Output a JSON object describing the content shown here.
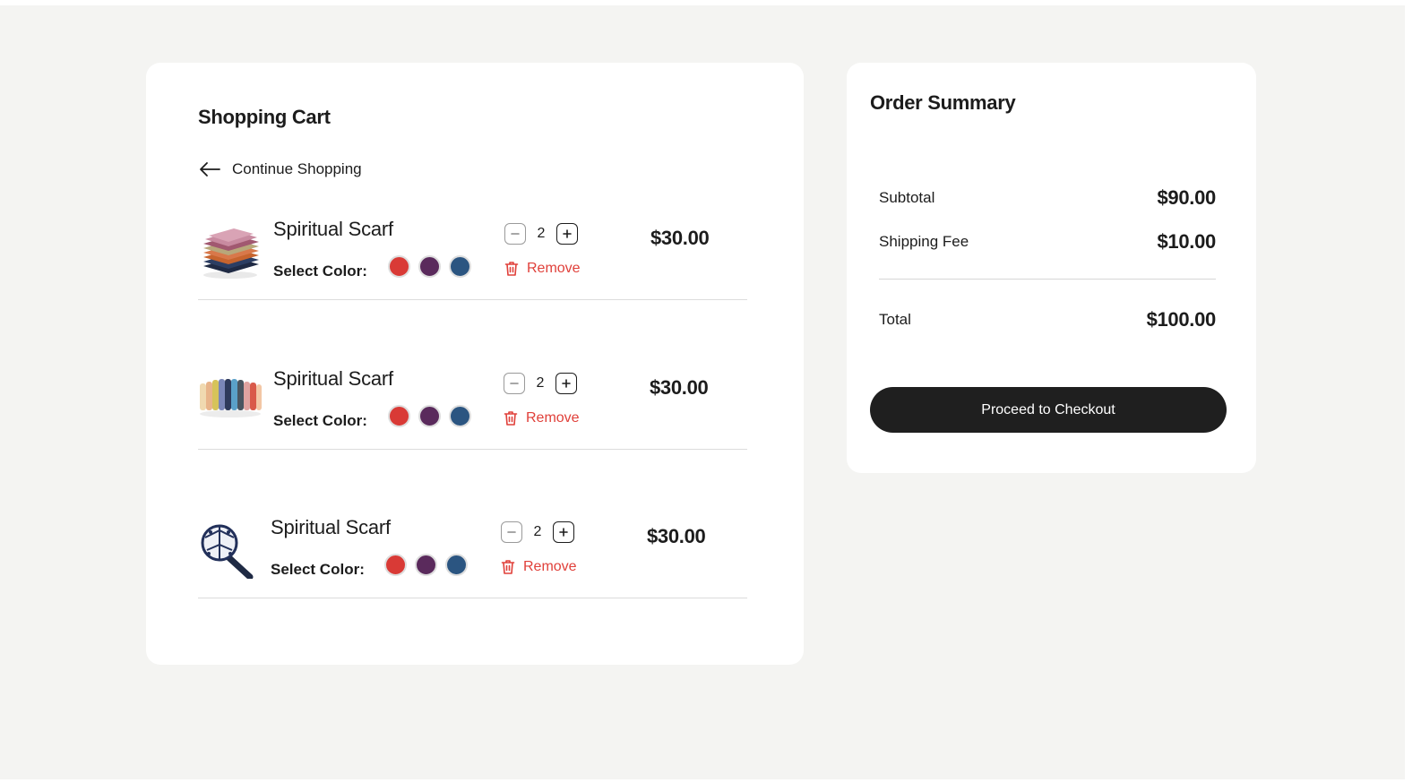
{
  "cart": {
    "title": "Shopping Cart",
    "continue_label": "Continue Shopping",
    "items": [
      {
        "name": "Spiritual Scarf",
        "color_label": "Select Color:",
        "quantity": "2",
        "remove_label": "Remove",
        "price": "$30.00",
        "image": "folded-scarves"
      },
      {
        "name": "Spiritual Scarf",
        "color_label": "Select Color:",
        "quantity": "2",
        "remove_label": "Remove",
        "price": "$30.00",
        "image": "rolled-scarves"
      },
      {
        "name": "Spiritual Scarf",
        "color_label": "Select Color:",
        "quantity": "2",
        "remove_label": "Remove",
        "price": "$30.00",
        "image": "beaded-cap"
      }
    ],
    "swatch_colors": [
      "#d93a36",
      "#5a2a5c",
      "#2b5581"
    ]
  },
  "summary": {
    "title": "Order Summary",
    "subtotal_label": "Subtotal",
    "subtotal_value": "$90.00",
    "shipping_label": "Shipping Fee",
    "shipping_value": "$10.00",
    "total_label": "Total",
    "total_value": "$100.00",
    "checkout_label": "Proceed to Checkout"
  },
  "colors": {
    "remove": "#e0403a",
    "checkout_bg": "#1f1f1f",
    "page_bg": "#f4f4f2"
  },
  "icons": {
    "back": "arrow-left-icon",
    "minus": "minus-icon",
    "plus": "plus-icon",
    "remove": "trash-icon"
  }
}
